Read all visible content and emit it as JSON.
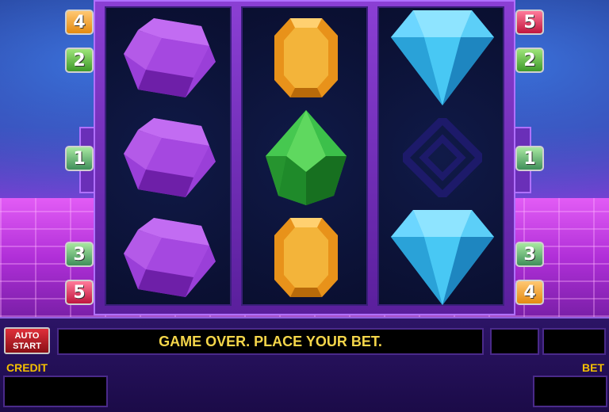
{
  "colors": {
    "accent": "#f5d64a",
    "frame": "#8b3fd4",
    "reel_bg": "#0a0f30"
  },
  "paylines": {
    "left": [
      "4",
      "2",
      "1",
      "3",
      "5"
    ],
    "right": [
      "5",
      "2",
      "1",
      "3",
      "4"
    ]
  },
  "reels": [
    {
      "symbols": [
        "purple-gem",
        "purple-gem",
        "purple-gem"
      ]
    },
    {
      "symbols": [
        "orange-gem",
        "green-gem",
        "orange-gem"
      ]
    },
    {
      "symbols": [
        "blue-diamond",
        "empty",
        "blue-diamond"
      ]
    }
  ],
  "controls": {
    "auto_start_line1": "AUTO",
    "auto_start_line2": "START",
    "message": "GAME OVER. PLACE YOUR BET.",
    "credit_label": "CREDIT",
    "bet_label": "BET"
  }
}
